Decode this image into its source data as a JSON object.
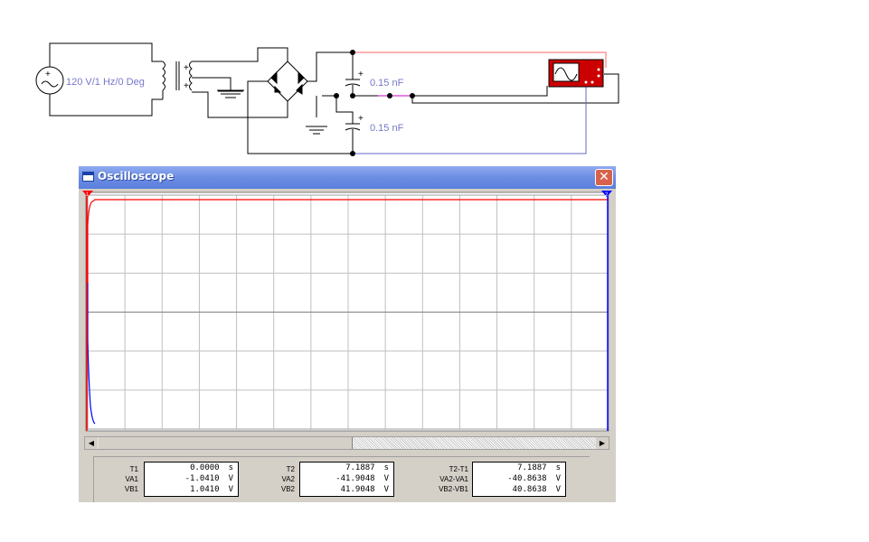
{
  "schematic": {
    "source_label": "120 V/1 Hz/0 Deg",
    "cap1_label": "0.15 nF",
    "cap2_label": "0.15 nF",
    "plus": "+",
    "minus": "−"
  },
  "window": {
    "title": "Oscilloscope",
    "close_glyph": "✕"
  },
  "cursors": {
    "c1": "1",
    "c2": "2"
  },
  "scrollbar": {
    "left": "◀",
    "right": "▶"
  },
  "readout": {
    "group1": [
      {
        "label": "T1",
        "value": "0.0000",
        "unit": "s"
      },
      {
        "label": "VA1",
        "value": "-1.0410",
        "unit": "V"
      },
      {
        "label": "VB1",
        "value": "1.0410",
        "unit": "V"
      }
    ],
    "group2": [
      {
        "label": "T2",
        "value": "7.1887",
        "unit": "s"
      },
      {
        "label": "VA2",
        "value": "-41.9048",
        "unit": "V"
      },
      {
        "label": "VB2",
        "value": "41.9048",
        "unit": "V"
      }
    ],
    "group3": [
      {
        "label": "T2-T1",
        "value": "7.1887",
        "unit": "s"
      },
      {
        "label": "VA2-VA1",
        "value": "-40.8638",
        "unit": "V"
      },
      {
        "label": "VB2-VB1",
        "value": "40.8638",
        "unit": "V"
      }
    ]
  },
  "colors": {
    "channel_a": "#ff0000",
    "channel_b": "#0000ff",
    "grid": "#c0c0c0",
    "title_bar": "#6d8de3"
  }
}
